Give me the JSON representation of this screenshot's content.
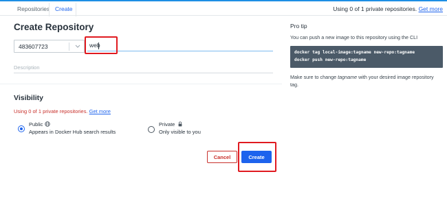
{
  "breadcrumb": {
    "items": [
      "Repositories",
      "Create"
    ]
  },
  "header": {
    "usage_text": "Using 0 of 1 private repositories.",
    "usage_link": "Get more"
  },
  "page": {
    "title": "Create Repository"
  },
  "form": {
    "namespace": "483607723",
    "name_value": "web",
    "description_placeholder": "Description"
  },
  "visibility": {
    "title": "Visibility",
    "usage_text": "Using 0 of 1 private repositories.",
    "usage_link": "Get more",
    "options": [
      {
        "label": "Public",
        "sub": "Appears in Docker Hub search results",
        "selected": true,
        "icon": "globe-icon"
      },
      {
        "label": "Private",
        "sub": "Only visible to you",
        "selected": false,
        "icon": "lock-icon"
      }
    ]
  },
  "actions": {
    "cancel_label": "Cancel",
    "create_label": "Create"
  },
  "pro_tip": {
    "title": "Pro tip",
    "text": "You can push a new image to this repository using the CLI",
    "code": [
      "docker tag local-image:tagname new-repo:tagname",
      "docker push new-repo:tagname"
    ],
    "note_before": "Make sure to change ",
    "note_em": "tagname",
    "note_after": " with your desired image repository tag."
  },
  "colors": {
    "accent": "#1d63ed",
    "danger": "#c8302b",
    "code_bg": "#4b5a68",
    "highlight": "#e0191f"
  }
}
